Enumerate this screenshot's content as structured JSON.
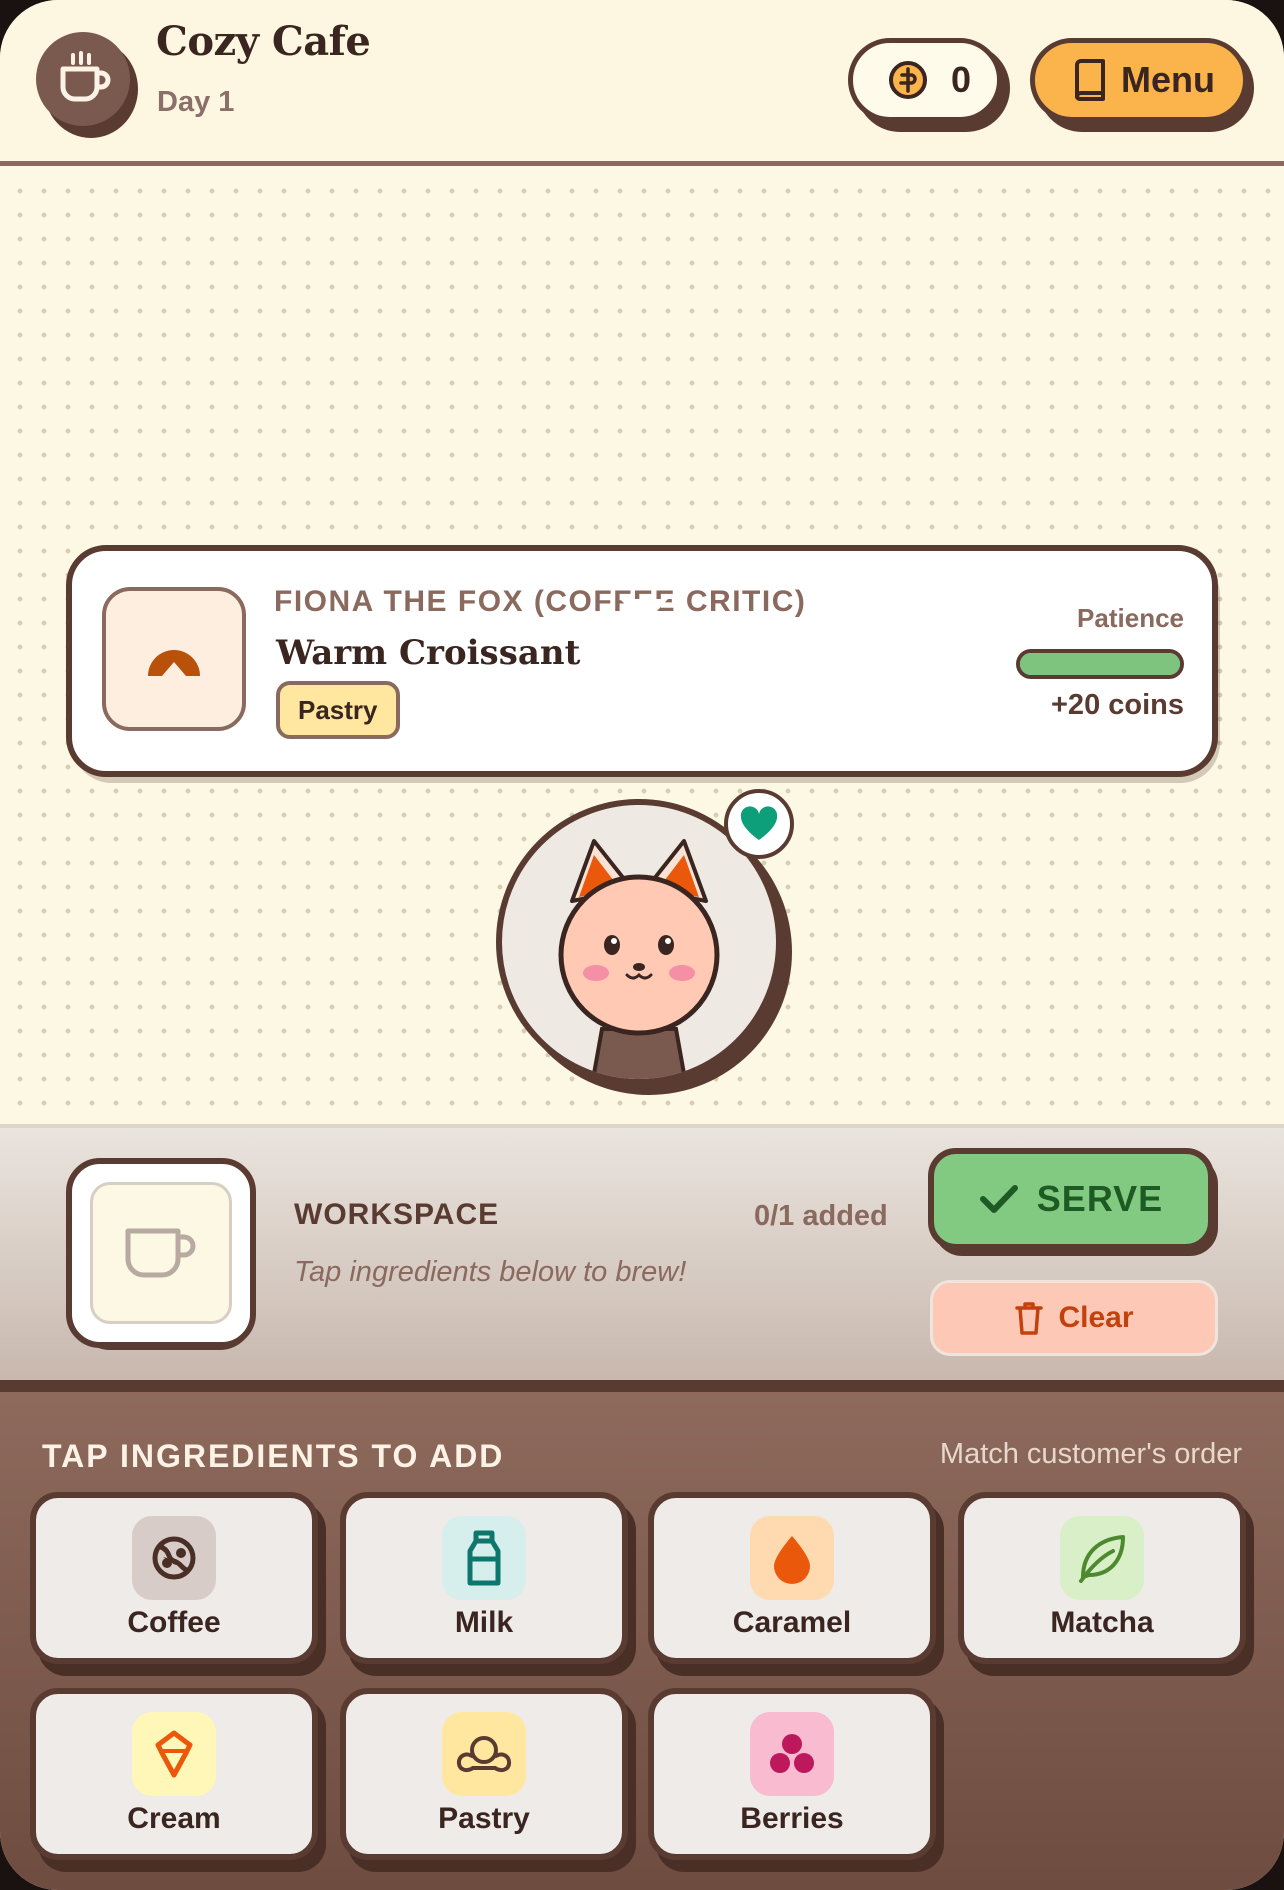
{
  "header": {
    "title": "Cozy Cafe",
    "day": "Day 1",
    "coins": "0",
    "menu_label": "Menu"
  },
  "order": {
    "customer": "FIONA THE FOX (COFFEE CRITIC)",
    "item": "Warm Croissant",
    "tag": "Pastry",
    "patience_label": "Patience",
    "patience_level": 1.0,
    "reward": "+20 coins"
  },
  "workspace": {
    "title": "WORKSPACE",
    "count": "0/1 added",
    "hint": "Tap ingredients below to brew!",
    "serve_label": "SERVE",
    "clear_label": "Clear"
  },
  "ingredients": {
    "title": "TAP INGREDIENTS TO ADD",
    "hint": "Match customer's order",
    "items": [
      {
        "label": "Coffee",
        "icon": "coffee-bean-icon",
        "bg": "#d7ccc8",
        "color": "#4a2f27"
      },
      {
        "label": "Milk",
        "icon": "milk-bottle-icon",
        "bg": "#d6eeec",
        "color": "#0f766e"
      },
      {
        "label": "Caramel",
        "icon": "caramel-drop-icon",
        "bg": "#ffd9b0",
        "color": "#ea580c"
      },
      {
        "label": "Matcha",
        "icon": "leaf-icon",
        "bg": "#d9efc8",
        "color": "#4d8a2f"
      },
      {
        "label": "Cream",
        "icon": "cream-cone-icon",
        "bg": "#fff7b8",
        "color": "#ea580c"
      },
      {
        "label": "Pastry",
        "icon": "croissant-icon",
        "bg": "#ffe7a0",
        "color": "#5a3b31"
      },
      {
        "label": "Berries",
        "icon": "berries-icon",
        "bg": "#f8bbd0",
        "color": "#be185d"
      }
    ]
  },
  "colors": {
    "brown": "#5a3b31",
    "accent_orange": "#fbb44c",
    "serve_green": "#82c982",
    "clear_peach": "#fdc9b6",
    "heart_teal": "#0d9f7a"
  }
}
